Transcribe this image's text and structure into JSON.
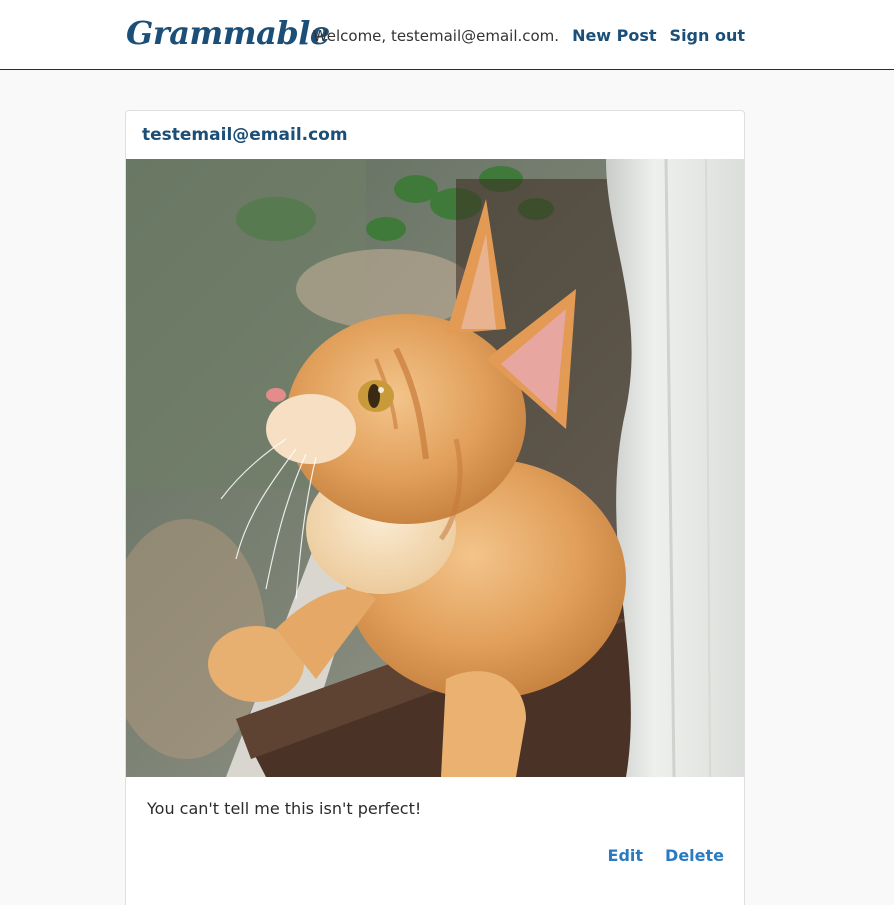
{
  "navbar": {
    "brand": "Grammable",
    "welcome_text": "Welcome, testemail@email.com.",
    "new_post_label": "New Post",
    "sign_out_label": "Sign out"
  },
  "post": {
    "author": "testemail@email.com",
    "image_alt": "orange tabby kitten sitting in a window planter",
    "caption": "You can't tell me this isn't perfect!",
    "edit_label": "Edit",
    "delete_label": "Delete"
  },
  "colors": {
    "brand": "#1c4f77",
    "action_link": "#2a7bc2",
    "page_background": "#f9f9f9"
  }
}
